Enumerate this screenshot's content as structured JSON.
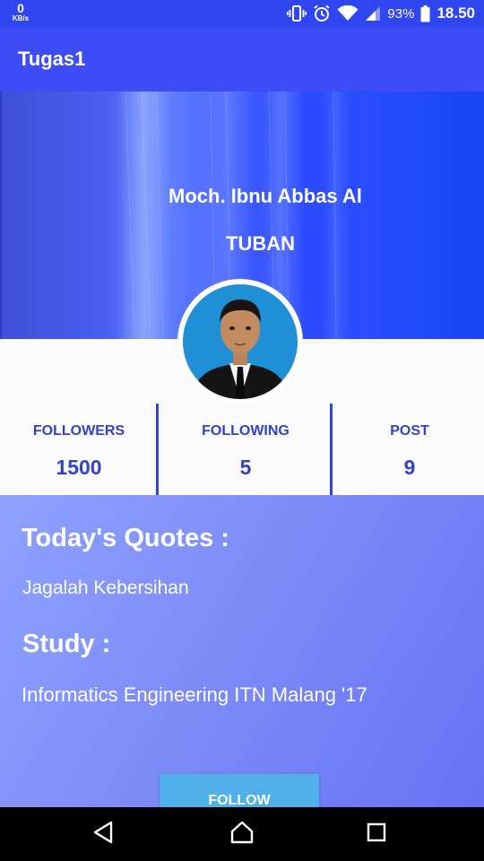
{
  "status_bar": {
    "speed_value": "0",
    "speed_unit": "KB/s",
    "battery_percent": "93%",
    "time": "18.50",
    "icons": [
      "vibrate-icon",
      "alarm-icon",
      "wifi-icon",
      "signal-icon",
      "battery-icon"
    ]
  },
  "app_bar": {
    "title": "Tugas1"
  },
  "profile": {
    "name": "Moch. Ibnu Abbas Al",
    "city": "TUBAN"
  },
  "stats": [
    {
      "label": "FOLLOWERS",
      "value": "1500"
    },
    {
      "label": "FOLLOWING",
      "value": "5"
    },
    {
      "label": "POST",
      "value": "9"
    }
  ],
  "content": {
    "quotes_heading": "Today's Quotes :",
    "quotes_text": "Jagalah Kebersihan",
    "study_heading": "Study :",
    "study_text": "Informatics Engineering ITN Malang '17",
    "follow_label": "FOLLOW"
  },
  "nav_bar": {
    "icons": [
      "back-icon",
      "home-icon",
      "recents-icon"
    ]
  },
  "colors": {
    "status_bar": "#2e45f0",
    "app_bar": "#3d4cf7",
    "stat_text": "#3343c5",
    "follow_button": "#4fb0ea"
  }
}
